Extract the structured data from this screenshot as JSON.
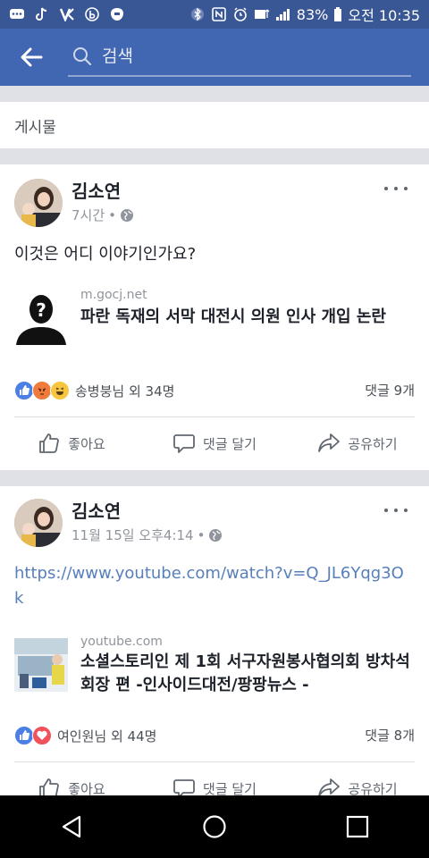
{
  "status_bar": {
    "battery_percent": "83%",
    "time": "오전 10:35"
  },
  "header": {
    "search_placeholder": "검색"
  },
  "section": {
    "label": "게시물"
  },
  "posts": [
    {
      "author": "김소연",
      "time": "7시간",
      "text": "이것은 어디 이야기인가요?",
      "link": {
        "domain": "m.gocj.net",
        "title": "파란 독재의 서막 대전시 의원 인사 개입 논란"
      },
      "reactions_text": "송병붕님 외 34명",
      "comments": "댓글 9개"
    },
    {
      "author": "김소연",
      "time": "11월 15일 오후4:14",
      "text": "https://www.youtube.com/watch?v=Q_JL6Yqg3Ok",
      "link": {
        "domain": "youtube.com",
        "title": "소셜스토리인 제 1회 서구자원봉사협의회 방차석 회장 편 -인사이드대전/팡팡뉴스 -"
      },
      "reactions_text": "여인원님 외 44명",
      "comments": "댓글 8개"
    }
  ],
  "actions": {
    "like": "좋아요",
    "comment": "댓글 달기",
    "share": "공유하기"
  },
  "colors": {
    "brand": "#4267b2",
    "status_bar": "#3a5795",
    "link": "#577fbc"
  }
}
